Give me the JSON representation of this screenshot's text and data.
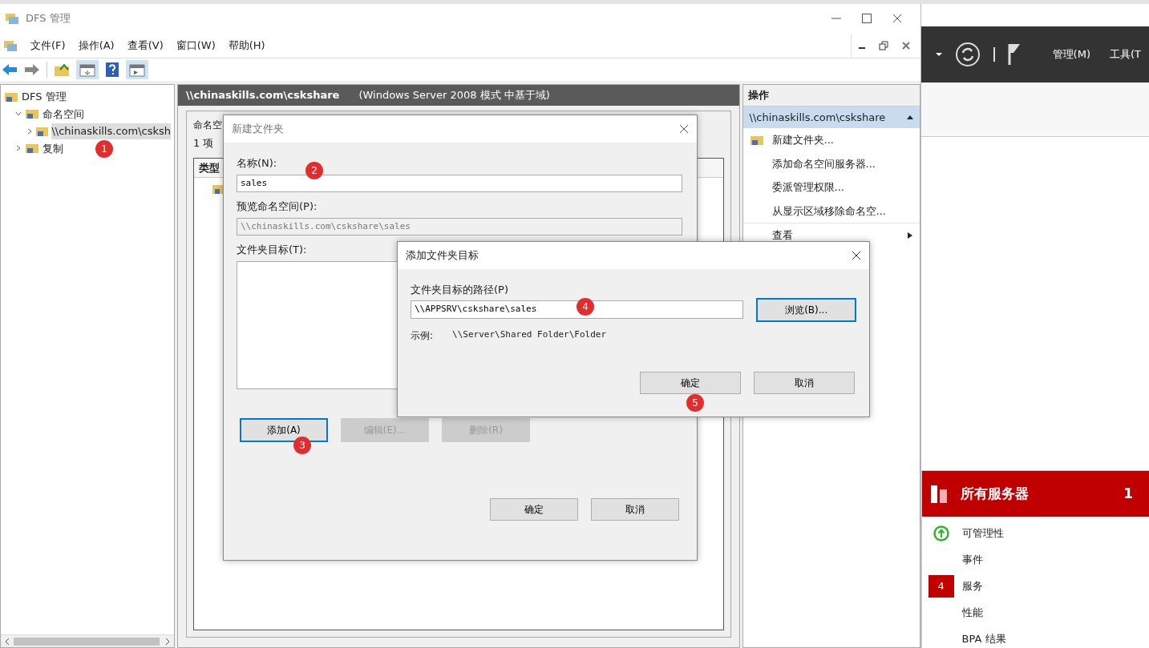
{
  "main_window": {
    "title": "DFS 管理"
  },
  "menu": [
    "文件(F)",
    "操作(A)",
    "查看(V)",
    "窗口(W)",
    "帮助(H)"
  ],
  "tree": {
    "label": "DFS 管理",
    "children": [
      {
        "label": "命名空间",
        "expanded": true,
        "selected": false,
        "children": [
          {
            "label": "\\\\chinaskills.com\\csksh",
            "expanded": false,
            "selected": true
          }
        ]
      },
      {
        "label": "复制",
        "expanded": false,
        "selected": false
      }
    ]
  },
  "center": {
    "path": "\\\\chinaskills.com\\cskshare",
    "mode": "(Windows Server 2008 模式 中基于域)",
    "tab": "命名空",
    "count": "1 项",
    "column": "类型"
  },
  "actions": {
    "header": "操作",
    "group": {
      "label": "\\\\chinaskills.com\\cskshare",
      "expanded": true
    },
    "items": [
      {
        "label": "新建文件夹...",
        "kind": "icon"
      },
      {
        "label": "添加命名空间服务器...",
        "kind": "plain"
      },
      {
        "label": "委派管理权限...",
        "kind": "plain"
      },
      {
        "label": "从显示区域移除命名空...",
        "kind": "plain"
      },
      {
        "label": "查看",
        "kind": "submenu"
      }
    ]
  },
  "new_folder_dialog": {
    "title": "新建文件夹",
    "name_label": "名称(N):",
    "name_value": "sales",
    "preview_label": "预览命名空间(P):",
    "preview_value": "\\\\chinaskills.com\\cskshare\\sales",
    "targets_label": "文件夹目标(T):",
    "target_buttons": [
      {
        "label": "添加(A)",
        "disabled": false,
        "focused": true
      },
      {
        "label": "编辑(E)...",
        "disabled": true,
        "focused": false
      },
      {
        "label": "删除(R)",
        "disabled": true,
        "focused": false
      }
    ],
    "buttons": [
      "确定",
      "取消"
    ]
  },
  "add_target_dialog": {
    "title": "添加文件夹目标",
    "path_label": "文件夹目标的路径(P)",
    "path_value": "\\\\APPSRV\\cskshare\\sales",
    "browse": {
      "label": "浏览(B)...",
      "focused": true
    },
    "example_label": "示例:",
    "example_value": "\\\\Server\\Shared Folder\\Folder",
    "buttons": [
      "确定",
      "取消"
    ]
  },
  "server_manager": {
    "menu": [
      "管理(M)",
      "工具(T"
    ],
    "tile": {
      "title": "所有服务器",
      "count": "1",
      "items": [
        {
          "label": "可管理性",
          "kind": "ok"
        },
        {
          "label": "事件",
          "kind": "plain"
        },
        {
          "label": "服务",
          "kind": "count",
          "count": "4"
        },
        {
          "label": "性能",
          "kind": "plain"
        },
        {
          "label": "BPA 结果",
          "kind": "plain"
        }
      ]
    }
  },
  "callouts": [
    "1",
    "2",
    "3",
    "4",
    "5"
  ]
}
